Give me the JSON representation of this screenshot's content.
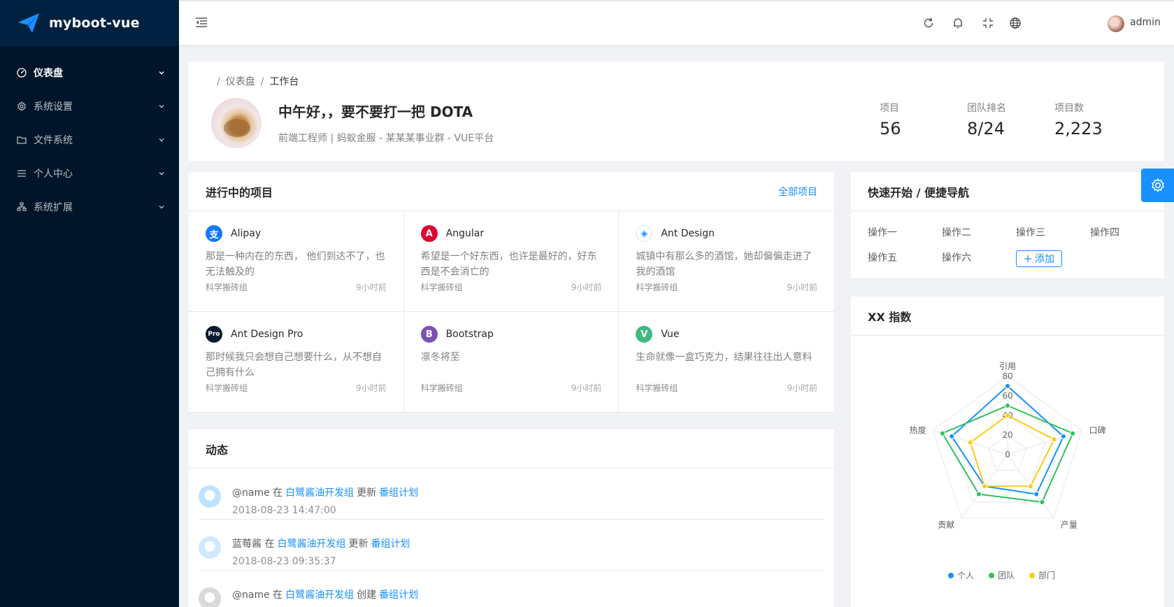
{
  "app": {
    "name": "myboot-vue",
    "brand_color": "#1890ff",
    "sider_color": "#001529"
  },
  "sidebar": {
    "items": [
      {
        "label": "仪表盘",
        "icon": "dashboard-icon",
        "active": true
      },
      {
        "label": "系统设置",
        "icon": "gear-icon",
        "active": false
      },
      {
        "label": "文件系统",
        "icon": "folder-icon",
        "active": false
      },
      {
        "label": "个人中心",
        "icon": "list-icon",
        "active": false
      },
      {
        "label": "系统扩展",
        "icon": "cluster-icon",
        "active": false
      }
    ]
  },
  "header": {
    "icons": [
      "menu-fold-icon",
      "reload-icon",
      "bell-icon",
      "fullscreen-icon",
      "globe-icon"
    ],
    "username": "admin"
  },
  "page_header": {
    "breadcrumb": [
      "仪表盘",
      "工作台"
    ],
    "greeting": "中午好，，要不要打一把 DOTA",
    "subtitle": "前端工程师 | 蚂蚁金服 - 某某某事业群 - VUE平台",
    "stats": [
      {
        "label": "项目",
        "value": "56"
      },
      {
        "label": "团队排名",
        "value": "8/24"
      },
      {
        "label": "项目数",
        "value": "2,223"
      }
    ]
  },
  "projects": {
    "title": "进行中的项目",
    "extra": "全部项目",
    "items": [
      {
        "name": "Alipay",
        "icon": "alipay-icon",
        "color": "#1677ff",
        "glyph": "支",
        "desc": "那是一种内在的东西， 他们到达不了，也无法触及的",
        "group": "科学搬砖组",
        "time": "9小时前"
      },
      {
        "name": "Angular",
        "icon": "angular-icon",
        "color": "#dd0031",
        "glyph": "A",
        "desc": "希望是一个好东西，也许是最好的，好东西是不会消亡的",
        "group": "科学搬砖组",
        "time": "9小时前"
      },
      {
        "name": "Ant Design",
        "icon": "ant-design-icon",
        "color": "#ffffff",
        "glyph": "◈",
        "desc": "城镇中有那么多的酒馆，她却偏偏走进了我的酒馆",
        "group": "科学搬砖组",
        "time": "9小时前"
      },
      {
        "name": "Ant Design Pro",
        "icon": "ant-design-pro-icon",
        "color": "#0b1a2e",
        "glyph": "Pro",
        "desc": "那时候我只会想自己想要什么，从不想自己拥有什么",
        "group": "科学搬砖组",
        "time": "9小时前"
      },
      {
        "name": "Bootstrap",
        "icon": "bootstrap-icon",
        "color": "#7952b3",
        "glyph": "B",
        "desc": "凛冬将至",
        "group": "科学搬砖组",
        "time": "9小时前"
      },
      {
        "name": "Vue",
        "icon": "vue-icon",
        "color": "#42b883",
        "glyph": "V",
        "desc": "生命就像一盒巧克力，结果往往出人意料",
        "group": "科学搬砖组",
        "time": "9小时前"
      }
    ]
  },
  "activity": {
    "title": "动态",
    "items": [
      {
        "user": "@name",
        "in": "在",
        "group": "白鹭酱油开发组",
        "action": "更新",
        "target": "番组计划",
        "time": "2018-08-23 14:47:00"
      },
      {
        "user": "蓝莓酱",
        "in": "在",
        "group": "白鹭酱油开发组",
        "action": "更新",
        "target": "番组计划",
        "time": "2018-08-23 09:35:37"
      },
      {
        "user": "@name",
        "in": "在",
        "group": "白鹭酱油开发组",
        "action": "创建",
        "target": "番组计划",
        "time": ""
      }
    ]
  },
  "quick_nav": {
    "title": "快速开始 / 便捷导航",
    "links": [
      "操作一",
      "操作二",
      "操作三",
      "操作四",
      "操作五",
      "操作六"
    ],
    "add_label": "添加"
  },
  "radar": {
    "title": "XX 指数",
    "chart_data": {
      "type": "radar",
      "indicators": [
        "引用",
        "口碑",
        "产量",
        "贡献",
        "热度"
      ],
      "max": 80,
      "ticks": [
        "0",
        "20",
        "40",
        "60",
        "80"
      ],
      "series": [
        {
          "name": "个人",
          "color": "#1890ff",
          "values": [
            70,
            60,
            50,
            40,
            60
          ]
        },
        {
          "name": "团队",
          "color": "#2fc25b",
          "values": [
            50,
            70,
            60,
            50,
            70
          ]
        },
        {
          "name": "部门",
          "color": "#facc14",
          "values": [
            40,
            50,
            40,
            40,
            40
          ]
        }
      ],
      "legend": "bottom"
    }
  }
}
